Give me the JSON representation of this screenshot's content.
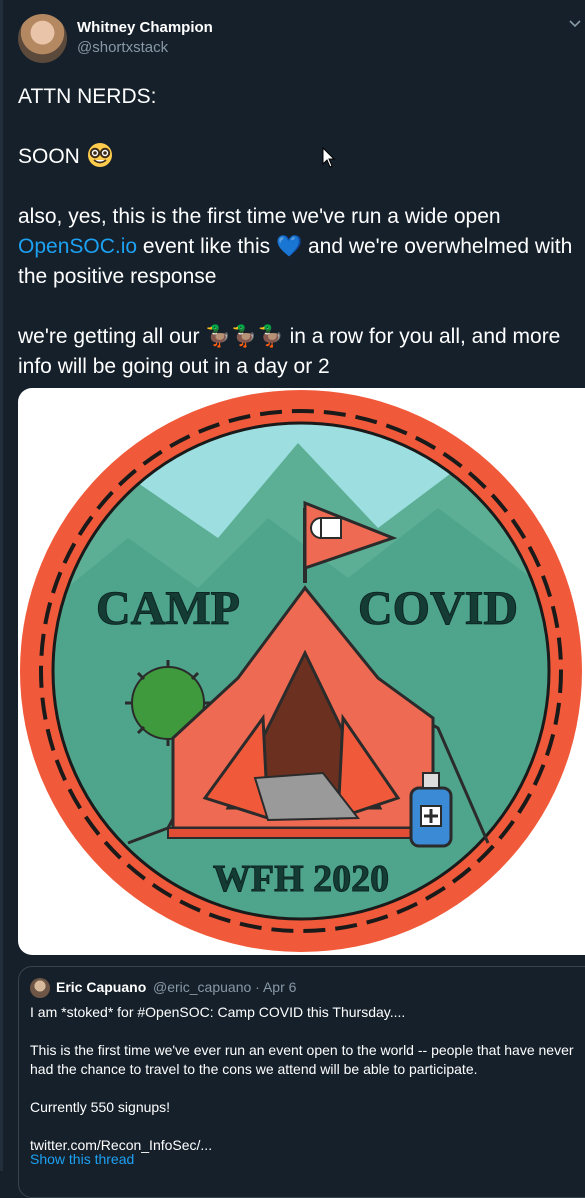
{
  "author": {
    "name": "Whitney Champion",
    "handle": "@shortxstack"
  },
  "tweet": {
    "line1": "ATTN NERDS:",
    "soon": "SOON",
    "soon_emoji": "nerd-face-emoji",
    "p2_before": "also, yes, this is the first time we've run a wide open ",
    "p2_link": "OpenSOC.io",
    "p2_after1": " event like this ",
    "heart": "💙",
    "p2_after2": " and we're overwhelmed with the positive response",
    "p3_before": "we're getting all our ",
    "ducks": "🦆🦆🦆",
    "p3_after": " in a row for you all, and more info will be going out in a day or 2"
  },
  "media": {
    "badge_text_left": "CAMP",
    "badge_text_right": "COVID",
    "badge_text_bottom": "WFH 2020",
    "colors": {
      "ring": "#f05a3a",
      "sky": "#9ddfe0",
      "mountain": "#4ea58c",
      "tent": "#ef6a52",
      "text": "#153b35"
    }
  },
  "quoted": {
    "name": "Eric Capuano",
    "handle": "@eric_capuano",
    "separator": "·",
    "date": "Apr 6",
    "text1": "I am *stoked* for #OpenSOC: Camp COVID this Thursday....",
    "text2": "This is the first time we've ever run an event open to the world -- people that have never had the chance to travel to the cons we attend will be able to participate.",
    "text3": "Currently 550 signups!",
    "text4": "twitter.com/Recon_InfoSec/...",
    "show_thread": "Show this thread"
  },
  "colors": {
    "background": "#15202b",
    "link": "#1da1f2",
    "secondary": "#8899a6",
    "border": "#38444d"
  }
}
